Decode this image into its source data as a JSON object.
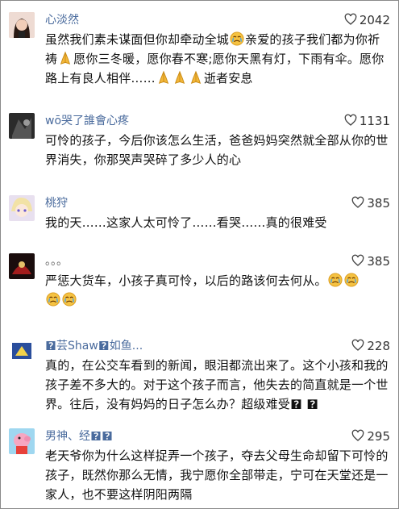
{
  "comments": [
    {
      "user": "心淡然",
      "likes": "2042",
      "avatar": "girl-avatar",
      "text_before": "虽然我们素未谋面但你却牵动全城",
      "text_mid": "亲爱的孩子我们都为你祈祷",
      "text_mid2": "愿你三冬暖，愿你春不寒;愿你天黑有灯，下雨有伞。愿你路上有良人相伴……",
      "text_after": "逝者安息"
    },
    {
      "user": "wō哭了誰會心疼",
      "likes": "1131",
      "avatar": "dark-avatar",
      "text": "可怜的孩子，今后你该怎么生活，爸爸妈妈突然就全部从你的世界消失，你那哭声哭碎了多少人的心"
    },
    {
      "user": "桃狩",
      "likes": "385",
      "avatar": "anime-avatar",
      "text": "我的天……这家人太可怜了……看哭……真的很难受"
    },
    {
      "user": "。。。",
      "likes": "385",
      "avatar": "red-avatar",
      "text": "严惩大货车，小孩子真可怜，以后的路该何去何从。"
    },
    {
      "user": "🯄芸Shaw🯄如鱼...",
      "likes": "228",
      "avatar": "blue-avatar",
      "text": "真的，在公交车看到的新闻，眼泪都流出来了。这个小孩和我的孩子差不多大的。对于这个孩子而言，他失去的简直就是一个世界。往后，没有妈妈的日子怎么办？超级难受🯄 🯄"
    },
    {
      "user": "男神、经🯄🯄",
      "likes": "295",
      "avatar": "peppa-avatar",
      "text": "老天爷你为什么这样捉弄一个孩子，夺去父母生命却留下可怜的孩子，既然你那么无情，我宁愿你全部带走，宁可在天堂还是一家人，也不要这样阴阳两隔"
    }
  ],
  "colors": {
    "username": "#4a6b9d",
    "text": "#111111",
    "likes": "#333333"
  }
}
